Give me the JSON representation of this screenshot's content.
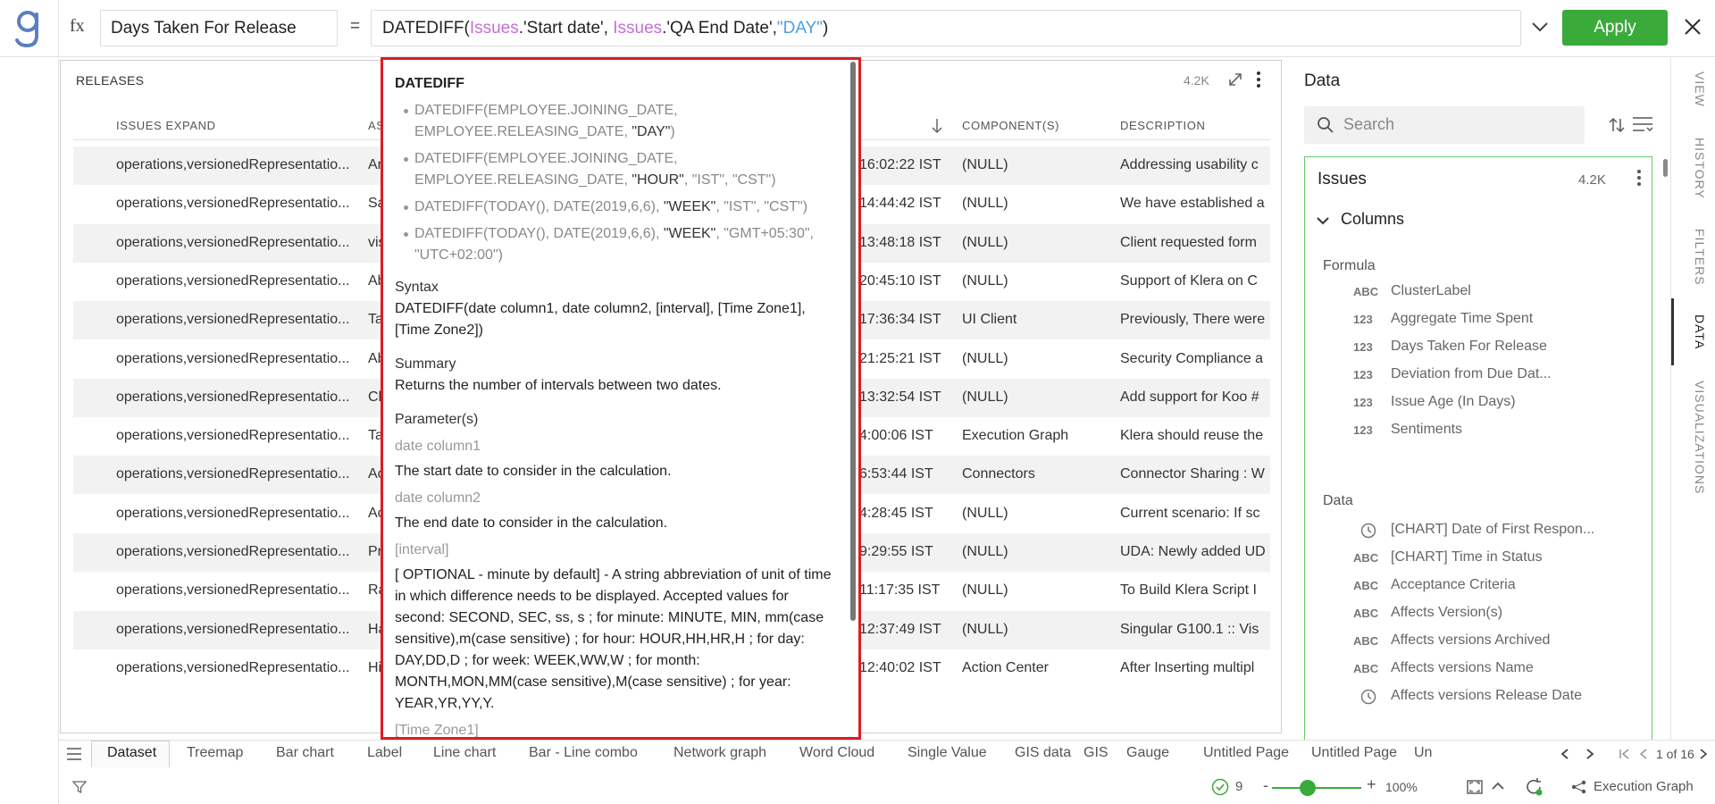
{
  "formula_bar": {
    "fx_label": "fx",
    "field_name": "Days Taken For Release",
    "equals": "=",
    "formula_parts": {
      "fn": "DATEDIFF(",
      "issues1": "Issues",
      "arg1": ".'Start date', ",
      "issues2": "Issues",
      "arg2": ".'QA End Date',",
      "str": "\"DAY\"",
      "close": ")"
    },
    "apply_label": "Apply"
  },
  "panel": {
    "title": "RELEASES",
    "count": "4.2K",
    "columns": [
      "ISSUES EXPAND",
      "AS",
      "COMPONENT(S)",
      "DESCRIPTION"
    ],
    "rows": [
      {
        "expand": "operations,versionedRepresentatio...",
        "as": "Ar",
        "time": "16:02:22 IST",
        "component": "(NULL)",
        "desc": "Addressing usability c"
      },
      {
        "expand": "operations,versionedRepresentatio...",
        "as": "Sa",
        "time": "14:44:42 IST",
        "component": "(NULL)",
        "desc": "We have established a"
      },
      {
        "expand": "operations,versionedRepresentatio...",
        "as": "vis",
        "time": "13:48:18 IST",
        "component": "(NULL)",
        "desc": "Client requested form"
      },
      {
        "expand": "operations,versionedRepresentatio...",
        "as": "Ab",
        "time": "20:45:10 IST",
        "component": "(NULL)",
        "desc": "Support of Klera on C"
      },
      {
        "expand": "operations,versionedRepresentatio...",
        "as": "Ta",
        "time": "17:36:34 IST",
        "component": "UI Client",
        "desc": "Previously, There were"
      },
      {
        "expand": "operations,versionedRepresentatio...",
        "as": "Ab",
        "time": "21:25:21 IST",
        "component": "(NULL)",
        "desc": "Security Compliance a"
      },
      {
        "expand": "operations,versionedRepresentatio...",
        "as": "Ch",
        "time": "13:32:54 IST",
        "component": "(NULL)",
        "desc": "Add support for Koo #"
      },
      {
        "expand": "operations,versionedRepresentatio...",
        "as": "Ta",
        "time": "4:00:06 IST",
        "component": "Execution Graph",
        "desc": "Klera should reuse the"
      },
      {
        "expand": "operations,versionedRepresentatio...",
        "as": "Ac",
        "time": "6:53:44 IST",
        "component": "Connectors",
        "desc": "Connector Sharing : W"
      },
      {
        "expand": "operations,versionedRepresentatio...",
        "as": "Ac",
        "time": "4:28:45 IST",
        "component": "(NULL)",
        "desc": "Current scenario: If sc"
      },
      {
        "expand": "operations,versionedRepresentatio...",
        "as": "Pr",
        "time": "9:29:55 IST",
        "component": "(NULL)",
        "desc": "UDA: Newly added UD"
      },
      {
        "expand": "operations,versionedRepresentatio...",
        "as": "Ra",
        "time": "11:17:35 IST",
        "component": "(NULL)",
        "desc": "To Build Klera Script I"
      },
      {
        "expand": "operations,versionedRepresentatio...",
        "as": "Ha",
        "time": "12:37:49 IST",
        "component": "(NULL)",
        "desc": "Singular G100.1 :: Vis"
      },
      {
        "expand": "operations,versionedRepresentatio...",
        "as": "Hi",
        "time": "12:40:02 IST",
        "component": "Action Center",
        "desc": "After Inserting multipl"
      }
    ]
  },
  "popup": {
    "title": "DATEDIFF",
    "examples": [
      {
        "pre": "DATEDIFF(EMPLOYEE.JOINING_DATE, EMPLOYEE.RELEASING_DATE, ",
        "kw": "\"DAY\"",
        "post": ")"
      },
      {
        "pre": "DATEDIFF(EMPLOYEE.JOINING_DATE, EMPLOYEE.RELEASING_DATE, ",
        "kw": "\"HOUR\"",
        "post": ", \"IST\", \"CST\")"
      },
      {
        "pre": "DATEDIFF(TODAY(), DATE(2019,6,6), ",
        "kw": "\"WEEK\"",
        "post": ", \"IST\", \"CST\")"
      },
      {
        "pre": "DATEDIFF(TODAY(), DATE(2019,6,6), ",
        "kw": "\"WEEK\"",
        "post": ", \"GMT+05:30\", \"UTC+02:00\")"
      }
    ],
    "syntax_label": "Syntax",
    "syntax": "DATEDIFF(date column1, date column2, [interval], [Time Zone1], [Time Zone2])",
    "summary_label": "Summary",
    "summary": "Returns the number of intervals between two dates.",
    "params_label": "Parameter(s)",
    "params": [
      {
        "name": "date column1",
        "desc": "The start date to consider in the calculation."
      },
      {
        "name": "date column2",
        "desc": "The end date to consider in the calculation."
      },
      {
        "name": "[interval]",
        "desc": "[ OPTIONAL - minute by default] - A string abbreviation of unit of time in which difference needs to be displayed. Accepted values for second: SECOND, SEC, ss, s ; for minute: MINUTE, MIN, mm(case sensitive),m(case sensitive) ; for hour: HOUR,HH,HR,H ; for day: DAY,DD,D ; for week: WEEK,WW,W ; for month: MONTH,MON,MM(case sensitive),M(case sensitive) ; for year: YEAR,YR,YY,Y."
      },
      {
        "name": "[Time Zone1]",
        "desc": ""
      }
    ]
  },
  "data_panel": {
    "title": "Data",
    "search_placeholder": "Search",
    "dataset": {
      "name": "Issues",
      "count": "4.2K"
    },
    "columns_label": "Columns",
    "formula_label": "Formula",
    "formula_fields": [
      {
        "type": "ABC",
        "name": "ClusterLabel"
      },
      {
        "type": "123",
        "name": "Aggregate Time Spent"
      },
      {
        "type": "123",
        "name": "Days Taken For Release"
      },
      {
        "type": "123",
        "name": "Deviation from Due Dat..."
      },
      {
        "type": "123",
        "name": "Issue Age (In Days)"
      },
      {
        "type": "123",
        "name": "Sentiments"
      }
    ],
    "data_label": "Data",
    "data_fields": [
      {
        "type": "clock",
        "name": "[CHART] Date of First Respon..."
      },
      {
        "type": "ABC",
        "name": "[CHART] Time in Status"
      },
      {
        "type": "ABC",
        "name": "Acceptance Criteria"
      },
      {
        "type": "ABC",
        "name": "Affects Version(s)"
      },
      {
        "type": "ABC",
        "name": "Affects versions Archived"
      },
      {
        "type": "ABC",
        "name": "Affects versions Name"
      },
      {
        "type": "clock",
        "name": "Affects versions Release Date"
      }
    ]
  },
  "vertical_tabs": [
    "VIEW",
    "HISTORY",
    "FILTERS",
    "DATA",
    "VISUALIZATIONS"
  ],
  "bottom_tabs": [
    "Dataset",
    "Treemap",
    "Bar chart",
    "Label",
    "Line chart",
    "Bar - Line combo",
    "Network graph",
    "Word Cloud",
    "Single Value",
    "GIS data",
    "GIS",
    "Gauge",
    "Untitled Page",
    "Untitled Page",
    "Un"
  ],
  "pager": {
    "text": "1 of 16"
  },
  "status": {
    "checks": "9",
    "zoom": "100%",
    "execution_graph": "Execution Graph"
  },
  "colors": {
    "accent": "#3aaa3a",
    "popup_border": "#e01b24",
    "issue_ref": "#c46fd6",
    "string_lit": "#4aa0e3"
  }
}
